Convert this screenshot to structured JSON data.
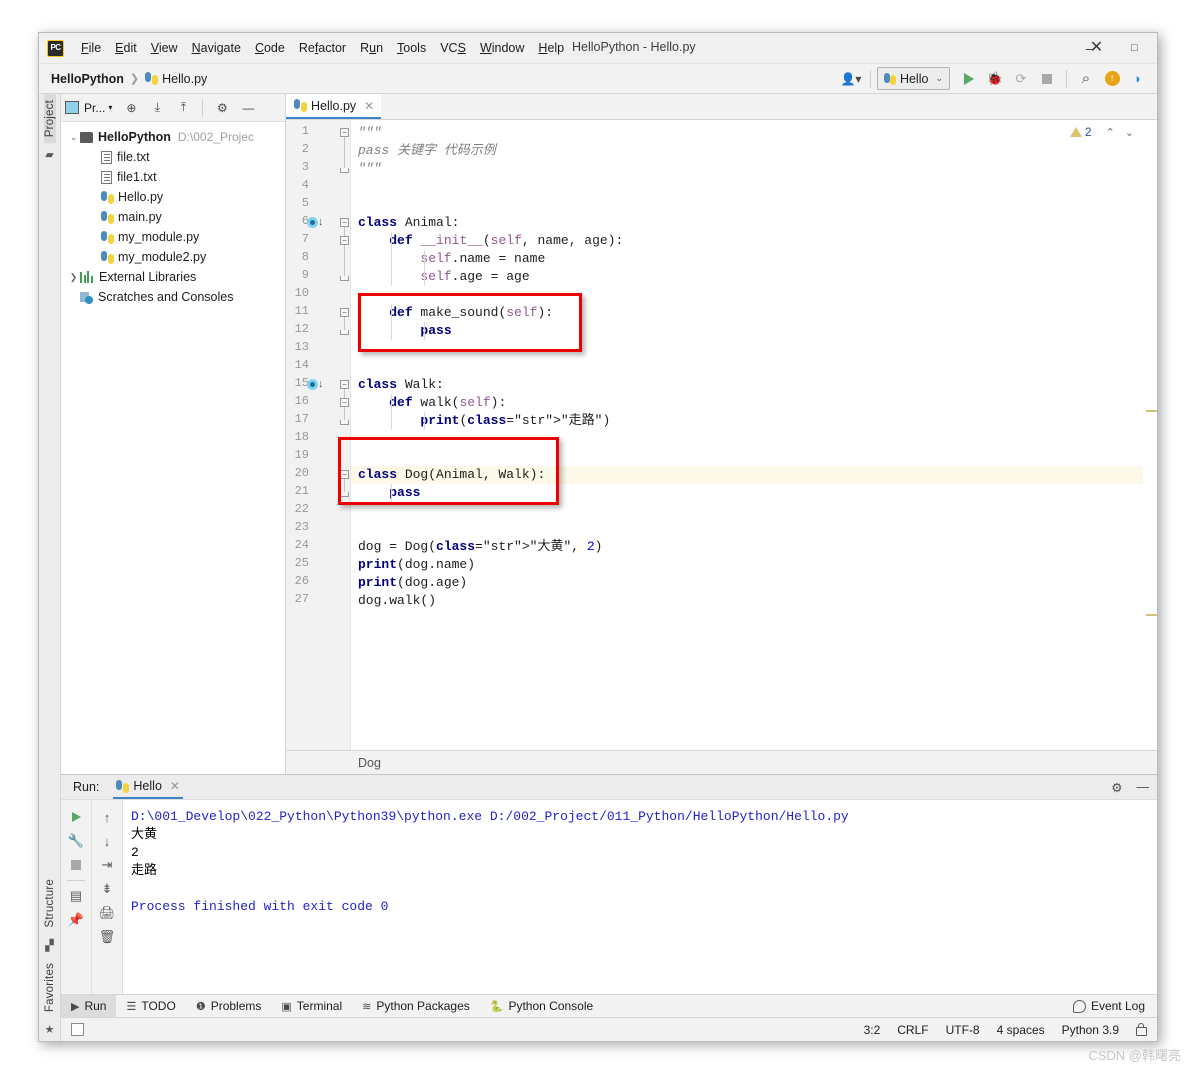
{
  "window": {
    "title": "HelloPython - Hello.py",
    "minimize": "–",
    "maximize": "□",
    "close": "✕"
  },
  "menu": {
    "items": [
      "File",
      "Edit",
      "View",
      "Navigate",
      "Code",
      "Refactor",
      "Run",
      "Tools",
      "VCS",
      "Window",
      "Help"
    ]
  },
  "breadcrumb": {
    "project": "HelloPython",
    "separator": "❯",
    "file": "Hello.py"
  },
  "toolbar": {
    "run_config": "Hello",
    "chevron": "⌄",
    "run_tooltip": "Run",
    "debug_tooltip": "Debug",
    "coverage_tooltip": "Run with Coverage",
    "stop_tooltip": "Stop",
    "search_icon": "⌕",
    "update_label": "↑",
    "profile_label": "▶"
  },
  "project_pane": {
    "header_label": "Pr...",
    "tree": [
      {
        "label": "HelloPython",
        "path": "D:\\002_Projec",
        "kind": "folder",
        "expanded": true,
        "indent": 0
      },
      {
        "label": "file.txt",
        "path": "",
        "kind": "text",
        "indent": 1
      },
      {
        "label": "file1.txt",
        "path": "",
        "kind": "text",
        "indent": 1
      },
      {
        "label": "Hello.py",
        "path": "",
        "kind": "python",
        "indent": 1
      },
      {
        "label": "main.py",
        "path": "",
        "kind": "python",
        "indent": 1
      },
      {
        "label": "my_module.py",
        "path": "",
        "kind": "python",
        "indent": 1
      },
      {
        "label": "my_module2.py",
        "path": "",
        "kind": "python",
        "indent": 1
      },
      {
        "label": "External Libraries",
        "path": "",
        "kind": "library",
        "collapsed": true,
        "indent": 0
      },
      {
        "label": "Scratches and Consoles",
        "path": "",
        "kind": "scratch",
        "indent": 0
      }
    ]
  },
  "left_strip": {
    "project_tab": "Project",
    "structure_tab": "Structure",
    "favorites_tab": "Favorites"
  },
  "editor": {
    "tab_label": "Hello.py",
    "tab_close": "✕",
    "inspection_count": "2",
    "inspection_up": "⌃",
    "inspection_down": "⌄",
    "breadcrumb": "Dog",
    "lines": [
      {
        "n": 1,
        "text": "\"\"\""
      },
      {
        "n": 2,
        "text": "pass 关键字 代码示例"
      },
      {
        "n": 3,
        "text": "\"\"\""
      },
      {
        "n": 4,
        "text": ""
      },
      {
        "n": 5,
        "text": ""
      },
      {
        "n": 6,
        "text": "class Animal:"
      },
      {
        "n": 7,
        "text": "    def __init__(self, name, age):"
      },
      {
        "n": 8,
        "text": "        self.name = name"
      },
      {
        "n": 9,
        "text": "        self.age = age"
      },
      {
        "n": 10,
        "text": ""
      },
      {
        "n": 11,
        "text": "    def make_sound(self):"
      },
      {
        "n": 12,
        "text": "        pass"
      },
      {
        "n": 13,
        "text": ""
      },
      {
        "n": 14,
        "text": ""
      },
      {
        "n": 15,
        "text": "class Walk:"
      },
      {
        "n": 16,
        "text": "    def walk(self):"
      },
      {
        "n": 17,
        "text": "        print(\"走路\")"
      },
      {
        "n": 18,
        "text": ""
      },
      {
        "n": 19,
        "text": ""
      },
      {
        "n": 20,
        "text": "class Dog(Animal, Walk):"
      },
      {
        "n": 21,
        "text": "    pass"
      },
      {
        "n": 22,
        "text": ""
      },
      {
        "n": 23,
        "text": ""
      },
      {
        "n": 24,
        "text": "dog = Dog(\"大黄\", 2)"
      },
      {
        "n": 25,
        "text": "print(dog.name)"
      },
      {
        "n": 26,
        "text": "print(dog.age)"
      },
      {
        "n": 27,
        "text": "dog.walk()"
      }
    ]
  },
  "run_panel": {
    "label": "Run:",
    "tab_label": "Hello",
    "tab_close": "✕",
    "settings_icon": "⚙",
    "minimize_icon": "—",
    "console": [
      "D:\\001_Develop\\022_Python\\Python39\\python.exe D:/002_Project/011_Python/HelloPython/Hello.py",
      "大黄",
      "2",
      "走路",
      "",
      "Process finished with exit code 0"
    ]
  },
  "tool_window_bar": {
    "items": [
      {
        "label": "Run",
        "icon": "▶",
        "selected": true
      },
      {
        "label": "TODO",
        "icon": "☰",
        "selected": false
      },
      {
        "label": "Problems",
        "icon": "❶",
        "selected": false
      },
      {
        "label": "Terminal",
        "icon": "▣",
        "selected": false
      },
      {
        "label": "Python Packages",
        "icon": "≋",
        "selected": false
      },
      {
        "label": "Python Console",
        "icon": "🐍",
        "selected": false
      }
    ],
    "event_log": "Event Log"
  },
  "status_bar": {
    "caret": "3:2",
    "line_separator": "CRLF",
    "encoding": "UTF-8",
    "indent": "4 spaces",
    "interpreter": "Python 3.9"
  },
  "watermark": "CSDN @韩曙亮",
  "colors": {
    "accent": "#4083c9",
    "run_green": "#59a869",
    "annotation_red": "#ee0000",
    "keyword": "#000080",
    "string": "#008000",
    "self_param": "#94558d",
    "comment": "#808080",
    "console_text": "#2222cc"
  }
}
